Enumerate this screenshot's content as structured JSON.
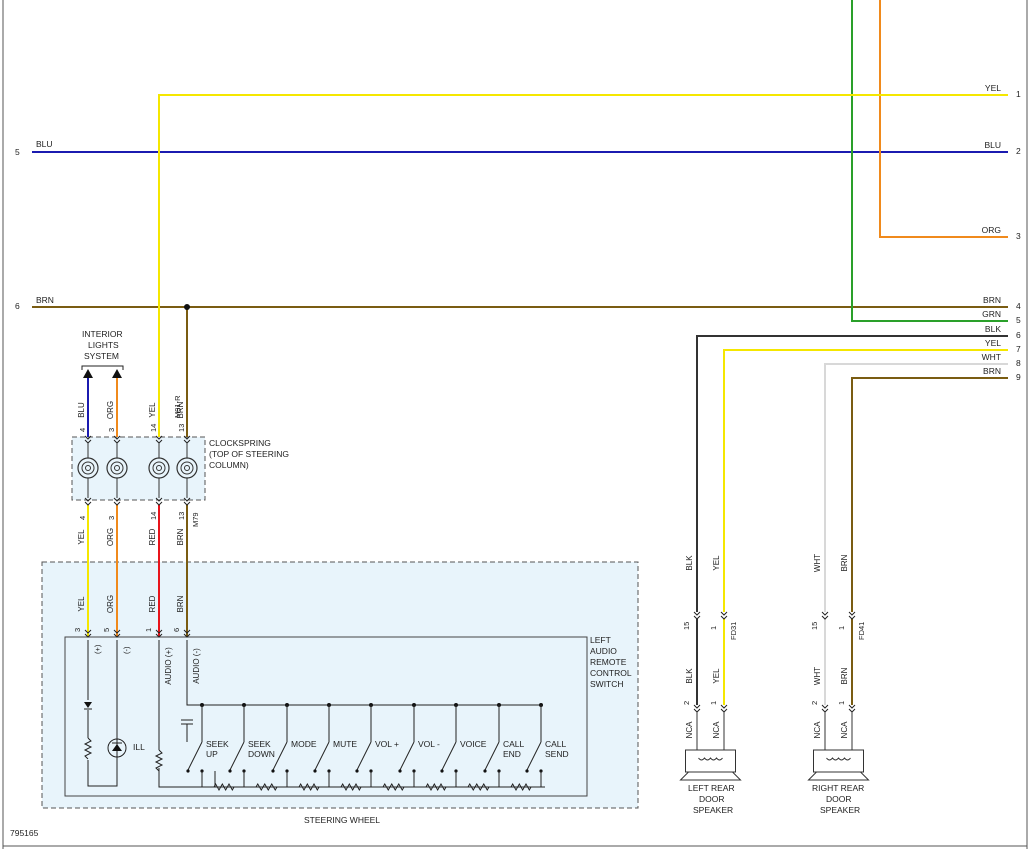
{
  "diagram_id": "795165",
  "steering_wheel_label": "STEERING WHEEL",
  "interior_lights_label": [
    "INTERIOR",
    "LIGHTS",
    "SYSTEM"
  ],
  "clockspring_label": [
    "CLOCKSPRING",
    "(TOP OF STEERING",
    "COLUMN)"
  ],
  "switch_label": [
    "LEFT",
    "AUDIO",
    "REMOTE",
    "CONTROL",
    "SWITCH"
  ],
  "left_speaker_label": [
    "LEFT REAR",
    "DOOR",
    "SPEAKER"
  ],
  "right_speaker_label": [
    "RIGHT REAR",
    "DOOR",
    "SPEAKER"
  ],
  "colors": {
    "YEL": "#f5e700",
    "BLU": "#1b1bb0",
    "ORG": "#f08a1c",
    "BRN": "#7a5c12",
    "GRN": "#2aa02a",
    "BLK": "#333333",
    "WHT": "#d8d8d8",
    "RED": "#e8141b"
  },
  "left_wires": [
    {
      "pin": "5",
      "color": "BLU"
    },
    {
      "pin": "6",
      "color": "BRN"
    }
  ],
  "right_connector": [
    {
      "pin": "1",
      "color": "YEL"
    },
    {
      "pin": "2",
      "color": "BLU"
    },
    {
      "pin": "3",
      "color": "ORG"
    },
    {
      "pin": "4",
      "color": "BRN"
    },
    {
      "pin": "5",
      "color": "GRN"
    },
    {
      "pin": "6",
      "color": "BLK"
    },
    {
      "pin": "7",
      "color": "YEL"
    },
    {
      "pin": "8",
      "color": "WHT"
    },
    {
      "pin": "9",
      "color": "BRN"
    }
  ],
  "clockspring_top": [
    {
      "pin": "4",
      "color": "BLU"
    },
    {
      "pin": "3",
      "color": "ORG"
    },
    {
      "pin": "14",
      "color": "YEL"
    },
    {
      "pin": "13",
      "color": "BRN"
    }
  ],
  "clockspring_top_connector": "M91-R",
  "clockspring_bottom": [
    {
      "pin": "4",
      "color": "YEL"
    },
    {
      "pin": "3",
      "color": "ORG"
    },
    {
      "pin": "14",
      "color": "RED"
    },
    {
      "pin": "13",
      "color": "BRN"
    }
  ],
  "clockspring_bottom_connector": "M79",
  "switch_pins": [
    {
      "pin": "3",
      "color": "YEL",
      "func": "(+)"
    },
    {
      "pin": "5",
      "color": "ORG",
      "func": "(-)"
    },
    {
      "pin": "1",
      "color": "RED",
      "func": "AUDIO (+)"
    },
    {
      "pin": "6",
      "color": "BRN",
      "func": "AUDIO (-)"
    }
  ],
  "ill_label": "ILL",
  "switch_buttons": [
    [
      "SEEK",
      "UP"
    ],
    [
      "SEEK",
      "DOWN"
    ],
    [
      "MODE"
    ],
    [
      "MUTE"
    ],
    [
      "VOL +"
    ],
    [
      "VOL -"
    ],
    [
      "VOICE"
    ],
    [
      "CALL",
      "END"
    ],
    [
      "CALL",
      "SEND"
    ]
  ],
  "left_speaker": {
    "connector": "FD31",
    "pins": [
      {
        "pin": "15",
        "color": "BLK"
      },
      {
        "pin": "1",
        "color": "YEL"
      }
    ],
    "speaker_pins": [
      {
        "pin": "2",
        "color": "BLK",
        "nca": "NCA"
      },
      {
        "pin": "1",
        "color": "YEL",
        "nca": "NCA"
      }
    ]
  },
  "right_speaker": {
    "connector": "FD41",
    "pins": [
      {
        "pin": "15",
        "color": "WHT"
      },
      {
        "pin": "1",
        "color": "BRN"
      }
    ],
    "speaker_pins": [
      {
        "pin": "2",
        "color": "WHT",
        "nca": "NCA"
      },
      {
        "pin": "1",
        "color": "BRN",
        "nca": "NCA"
      }
    ]
  }
}
